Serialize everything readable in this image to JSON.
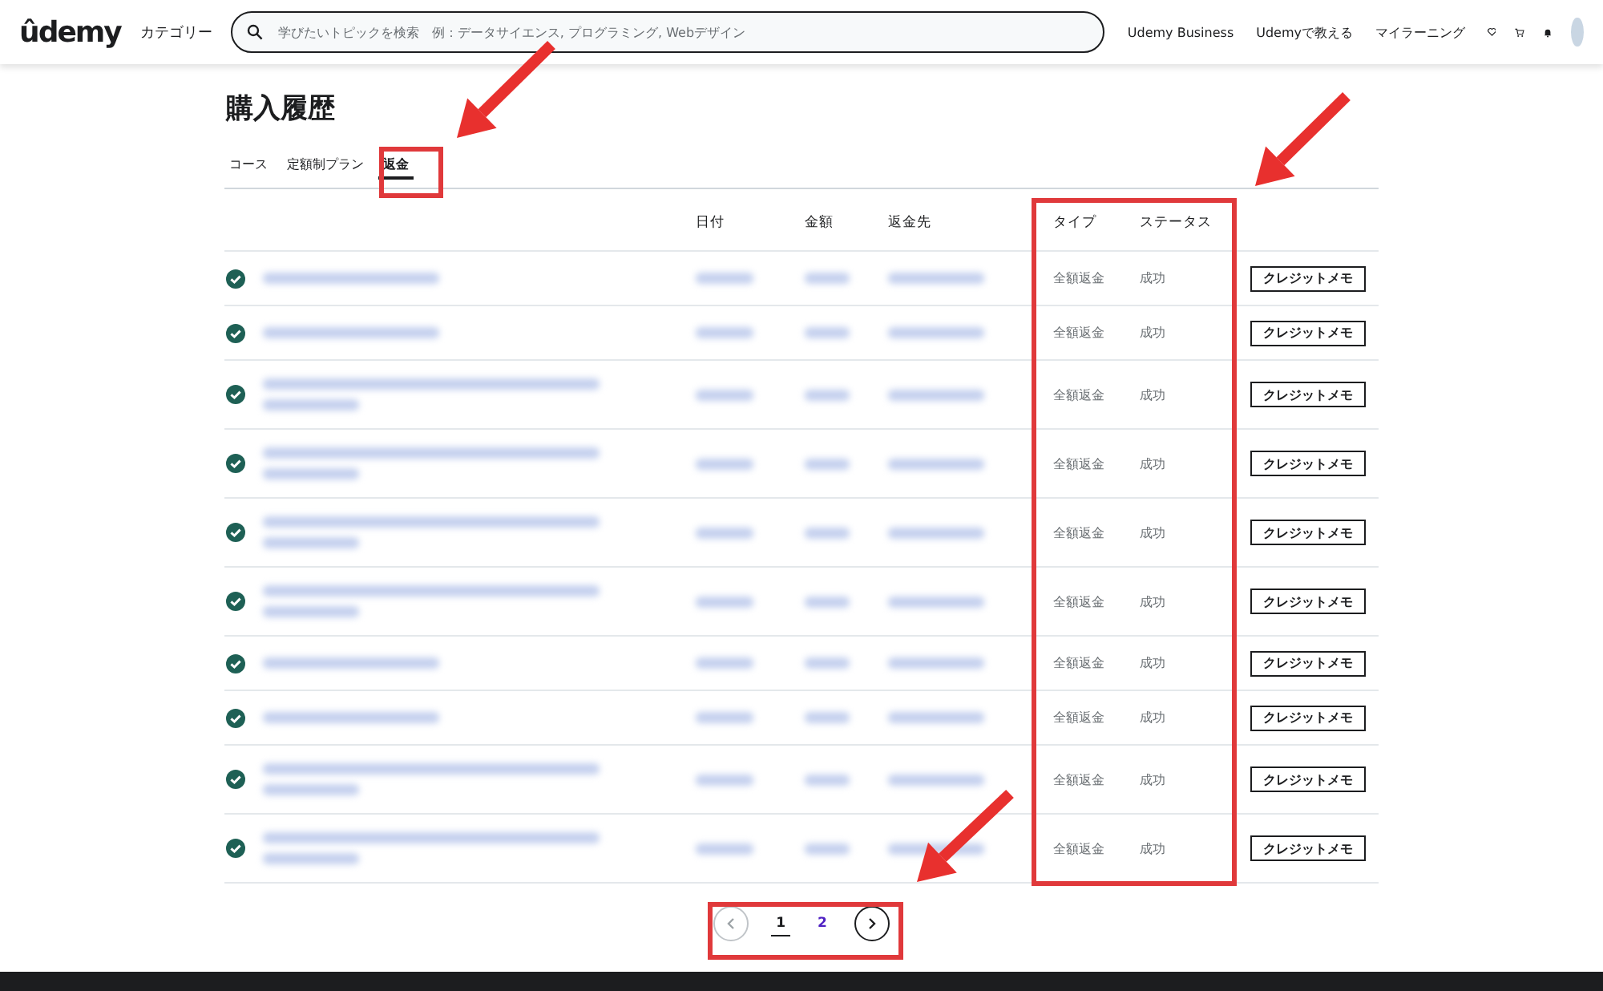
{
  "header": {
    "logo": "ûdemy",
    "categories": "カテゴリー",
    "search": {
      "placeholder": "学びたいトピックを検索　例：データサイエンス, プログラミング, Webデザイン"
    },
    "links": [
      "Udemy Business",
      "Udemyで教える",
      "マイラーニング"
    ]
  },
  "page_title": "購入履歴",
  "tabs": [
    {
      "label": "コース",
      "selected": false
    },
    {
      "label": "定額制プラン",
      "selected": false
    },
    {
      "label": "返金",
      "selected": true
    }
  ],
  "table": {
    "columns": [
      "日付",
      "金額",
      "返金先",
      "タイプ",
      "ステータス"
    ],
    "rows": [
      {
        "kind": "single",
        "type": "全額返金",
        "status": "成功",
        "action": "クレジットメモ"
      },
      {
        "kind": "single",
        "type": "全額返金",
        "status": "成功",
        "action": "クレジットメモ"
      },
      {
        "kind": "double",
        "type": "全額返金",
        "status": "成功",
        "action": "クレジットメモ"
      },
      {
        "kind": "double",
        "type": "全額返金",
        "status": "成功",
        "action": "クレジットメモ"
      },
      {
        "kind": "double",
        "type": "全額返金",
        "status": "成功",
        "action": "クレジットメモ"
      },
      {
        "kind": "double",
        "type": "全額返金",
        "status": "成功",
        "action": "クレジットメモ"
      },
      {
        "kind": "single",
        "type": "全額返金",
        "status": "成功",
        "action": "クレジットメモ"
      },
      {
        "kind": "single",
        "type": "全額返金",
        "status": "成功",
        "action": "クレジットメモ"
      },
      {
        "kind": "double",
        "type": "全額返金",
        "status": "成功",
        "action": "クレジットメモ"
      },
      {
        "kind": "double",
        "type": "全額返金",
        "status": "成功",
        "action": "クレジットメモ"
      }
    ]
  },
  "pagination": {
    "pages": [
      {
        "label": "1",
        "selected": true
      },
      {
        "label": "2",
        "selected": false
      }
    ]
  }
}
